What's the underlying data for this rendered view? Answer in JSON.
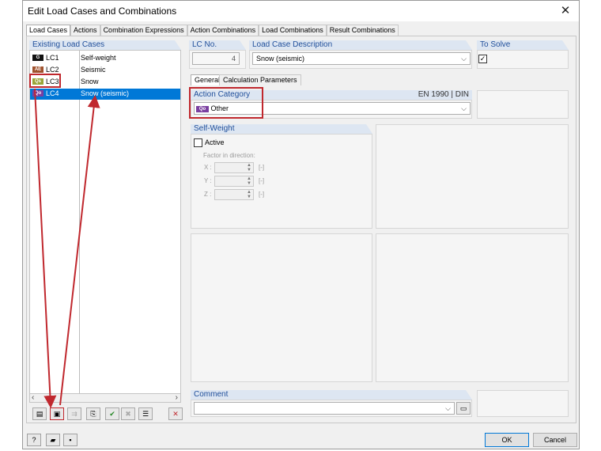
{
  "window": {
    "title": "Edit Load Cases and Combinations"
  },
  "tabs": [
    {
      "label": "Load Cases"
    },
    {
      "label": "Actions"
    },
    {
      "label": "Combination Expressions"
    },
    {
      "label": "Action Combinations"
    },
    {
      "label": "Load Combinations"
    },
    {
      "label": "Result Combinations"
    }
  ],
  "load_cases": {
    "header": "Existing Load Cases",
    "rows": [
      {
        "badge": "G",
        "badge_color": "#111111",
        "code": "LC1",
        "desc": "Self-weight"
      },
      {
        "badge": "AE",
        "badge_color": "#a0522d",
        "code": "LC2",
        "desc": "Seismic"
      },
      {
        "badge": "Qs",
        "badge_color": "#9aa538",
        "code": "LC3",
        "desc": "Snow"
      },
      {
        "badge": "Qo",
        "badge_color": "#7a3fa0",
        "code": "LC4",
        "desc": "Snow (seismic)"
      }
    ],
    "selected_index": 3
  },
  "lc_no": {
    "label": "LC No.",
    "value": "4"
  },
  "description": {
    "label": "Load Case Description",
    "value": "Snow (seismic)"
  },
  "to_solve": {
    "label": "To Solve",
    "checked": true
  },
  "subtabs": [
    {
      "label": "General"
    },
    {
      "label": "Calculation Parameters"
    }
  ],
  "action_category": {
    "label": "Action Category",
    "standard": "EN 1990 | DIN",
    "badge": "Qo",
    "badge_color": "#7a3fa0",
    "value": "Other"
  },
  "self_weight": {
    "label": "Self-Weight",
    "active_label": "Active",
    "factor_label": "Factor in direction:",
    "directions": [
      {
        "axis": "X :",
        "unit": "[-]"
      },
      {
        "axis": "Y :",
        "unit": "[-]"
      },
      {
        "axis": "Z :",
        "unit": "[-]"
      }
    ]
  },
  "comment": {
    "label": "Comment",
    "value": ""
  },
  "buttons": {
    "ok": "OK",
    "cancel": "Cancel"
  },
  "annotation_color": "#c0282e"
}
